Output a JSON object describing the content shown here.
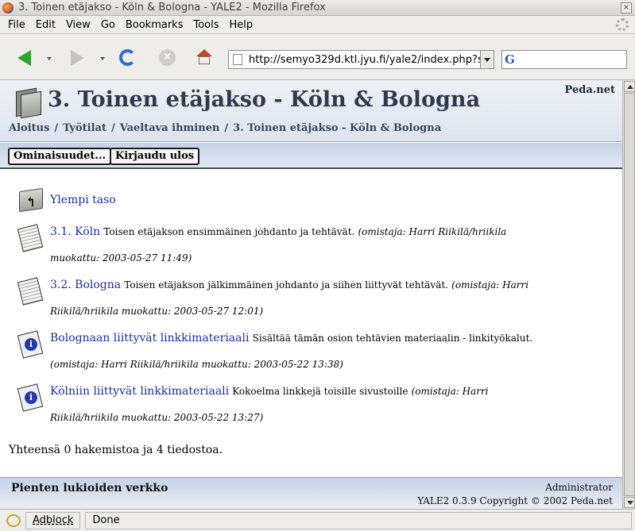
{
  "window": {
    "title": "3. Toinen etäjakso - Köln & Bologna - YALE2 - Mozilla Firefox",
    "close_glyph": "×"
  },
  "menubar": {
    "items": [
      "File",
      "Edit",
      "View",
      "Go",
      "Bookmarks",
      "Tools",
      "Help"
    ]
  },
  "toolbar": {
    "url": "http://semyo329d.ktl.jyu.fi/yale2/index.php?s",
    "search_engine_glyph": "G",
    "search_value": ""
  },
  "page": {
    "title": "3. Toinen etäjakso - Köln & Bologna",
    "site_name": "Peda.net",
    "breadcrumb": [
      "Aloitus",
      "Työtilat",
      "Vaeltava ihminen",
      "3. Toinen etäjakso - Köln & Bologna"
    ],
    "breadcrumb_separator": "/",
    "actions": {
      "properties_label": "Ominaisuudet...",
      "logout_label": "Kirjaudu ulos"
    },
    "up_level_label": "Ylempi taso",
    "items": [
      {
        "icon": "document-icon",
        "link": "3.1. Köln",
        "desc": "Toisen etäjakson ensimmäinen johdanto ja tehtävät.",
        "meta1": "(omistaja: Harri Riikilä/hriikila",
        "meta2": "muokattu: 2003-05-27 11:49)"
      },
      {
        "icon": "document-icon",
        "link": "3.2. Bologna",
        "desc": "Toisen etäjakson jälkimmäinen johdanto ja siihen liittyvät tehtävät.",
        "meta1": "(omistaja: Harri",
        "meta2": "Riikilä/hriikila muokattu: 2003-05-27 12:01)"
      },
      {
        "icon": "info-icon",
        "link": "Bolognaan liittyvät linkkimateriaali",
        "desc": "Sisältää tämän osion tehtävien materiaalin - linkityökalut.",
        "meta1": "",
        "meta2": "(omistaja: Harri Riikilä/hriikila muokattu: 2003-05-22 13:38)"
      },
      {
        "icon": "info-icon",
        "link": "Kölniin liittyvät linkkimateriaali",
        "desc": "Kokoelma linkkejä toisille sivustoille",
        "meta1": "(omistaja: Harri",
        "meta2": "Riikilä/hriikila muokattu: 2003-05-22 13:27)"
      }
    ],
    "summary": "Yhteensä 0 hakemistoa ja 4 tiedostoa.",
    "footer": {
      "org": "Pienten lukioiden verkko",
      "user": "Administrator",
      "copyright": "YALE2 0.3.9 Copyright © 2002 Peda.net"
    }
  },
  "statusbar": {
    "adblock_label": "Adblock",
    "status_text": "Done"
  }
}
